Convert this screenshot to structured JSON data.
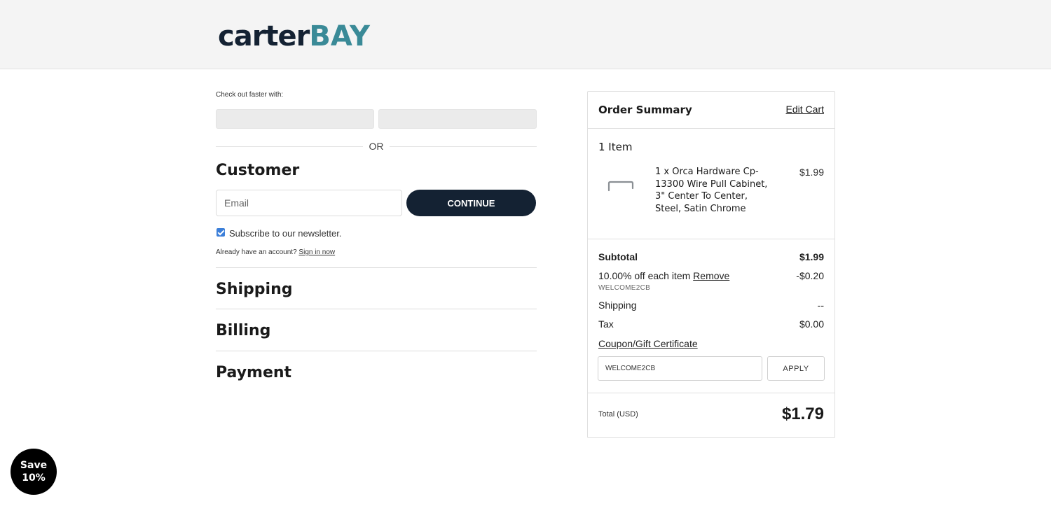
{
  "header": {
    "logo_part1": "carter",
    "logo_part2": "BAY"
  },
  "checkout": {
    "faster_label": "Check out faster with:",
    "or_label": "OR",
    "customer_heading": "Customer",
    "email_placeholder": "Email",
    "continue_label": "CONTINUE",
    "newsletter_label": "Subscribe to our newsletter.",
    "newsletter_checked": true,
    "account_prompt": "Already have an account?",
    "sign_in_label": "Sign in now",
    "shipping_heading": "Shipping",
    "billing_heading": "Billing",
    "payment_heading": "Payment"
  },
  "summary": {
    "title": "Order Summary",
    "edit_cart": "Edit Cart",
    "items_count": "1 Item",
    "item": {
      "name": "1 x Orca Hardware Cp-13300 Wire Pull Cabinet, 3\" Center To Center, Steel, Satin Chrome",
      "price": "$1.99"
    },
    "subtotal_label": "Subtotal",
    "subtotal_value": "$1.99",
    "discount_label": "10.00% off each item",
    "discount_remove": "Remove",
    "discount_value": "-$0.20",
    "discount_code": "WELCOME2CB",
    "shipping_label": "Shipping",
    "shipping_value": "--",
    "tax_label": "Tax",
    "tax_value": "$0.00",
    "coupon_label": "Coupon/Gift Certificate",
    "coupon_value": "WELCOME2CB",
    "apply_label": "APPLY",
    "total_label": "Total (USD)",
    "total_value": "$1.79"
  },
  "badge": {
    "line1": "Save",
    "line2": "10%"
  },
  "colors": {
    "brand_dark": "#142233",
    "brand_teal": "#3a8a97",
    "checkbox": "#3c7fd9"
  }
}
